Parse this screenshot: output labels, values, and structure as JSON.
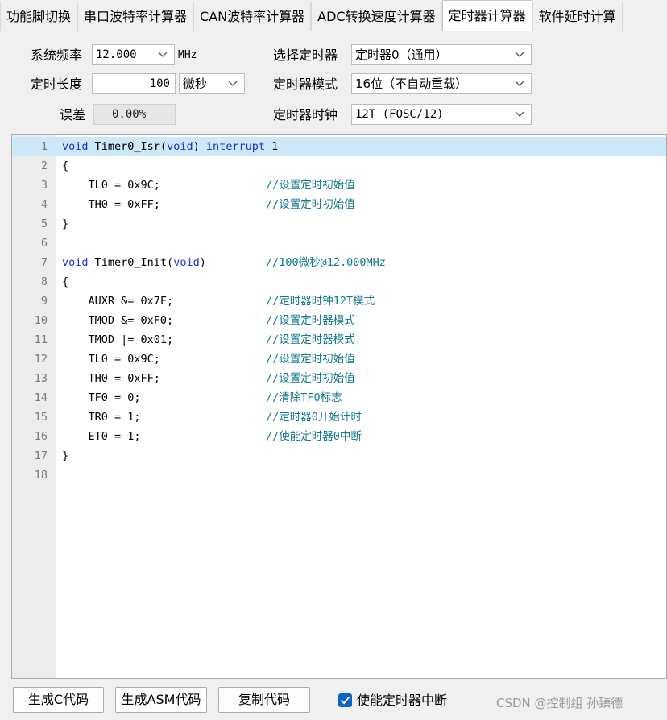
{
  "tabs": [
    "功能脚切换",
    "串口波特率计算器",
    "CAN波特率计算器",
    "ADC转换速度计算器",
    "定时器计算器",
    "软件延时计算"
  ],
  "active_tab": 4,
  "settings": {
    "sysfreq_label": "系统频率",
    "sysfreq_value": "12.000",
    "sysfreq_unit": "MHz",
    "timelen_label": "定时长度",
    "timelen_value": "100",
    "timeunit_value": "微秒",
    "error_label": "误差",
    "error_value": "0.00%",
    "timer_select_label": "选择定时器",
    "timer_select_value": "定时器0（通用）",
    "timer_mode_label": "定时器模式",
    "timer_mode_value": "16位（不自动重载）",
    "timer_clock_label": "定时器时钟",
    "timer_clock_value": "12T (FOSC/12)"
  },
  "code_lines": [
    {
      "n": "1",
      "code": "void Timer0_Isr(void) interrupt 1",
      "comment": ""
    },
    {
      "n": "2",
      "code": "{",
      "comment": ""
    },
    {
      "n": "3",
      "code": "    TL0 = 0x9C;",
      "comment": "//设置定时初始值"
    },
    {
      "n": "4",
      "code": "    TH0 = 0xFF;",
      "comment": "//设置定时初始值"
    },
    {
      "n": "5",
      "code": "}",
      "comment": ""
    },
    {
      "n": "6",
      "code": "",
      "comment": ""
    },
    {
      "n": "7",
      "code": "void Timer0_Init(void)",
      "comment": "//100微秒@12.000MHz"
    },
    {
      "n": "8",
      "code": "{",
      "comment": ""
    },
    {
      "n": "9",
      "code": "    AUXR &= 0x7F;",
      "comment": "//定时器时钟12T模式"
    },
    {
      "n": "10",
      "code": "    TMOD &= 0xF0;",
      "comment": "//设置定时器模式"
    },
    {
      "n": "11",
      "code": "    TMOD |= 0x01;",
      "comment": "//设置定时器模式"
    },
    {
      "n": "12",
      "code": "    TL0 = 0x9C;",
      "comment": "//设置定时初始值"
    },
    {
      "n": "13",
      "code": "    TH0 = 0xFF;",
      "comment": "//设置定时初始值"
    },
    {
      "n": "14",
      "code": "    TF0 = 0;",
      "comment": "//清除TF0标志"
    },
    {
      "n": "15",
      "code": "    TR0 = 1;",
      "comment": "//定时器0开始计时"
    },
    {
      "n": "16",
      "code": "    ET0 = 1;",
      "comment": "//使能定时器0中断"
    },
    {
      "n": "17",
      "code": "}",
      "comment": ""
    },
    {
      "n": "18",
      "code": "",
      "comment": ""
    }
  ],
  "current_line": 1,
  "bottom": {
    "gen_c_label": "生成C代码",
    "gen_asm_label": "生成ASM代码",
    "copy_label": "复制代码",
    "enable_int_label": "使能定时器中断",
    "enable_int_checked": true
  },
  "watermark": "CSDN @控制组 孙臻德",
  "colors": {
    "keyword": "#1f2fd6",
    "comment": "#127a8a",
    "current_line": "#cde8f7",
    "checkbox": "#0a64c8"
  },
  "icons": [
    "chevron-down-icon",
    "checkmark-icon"
  ]
}
